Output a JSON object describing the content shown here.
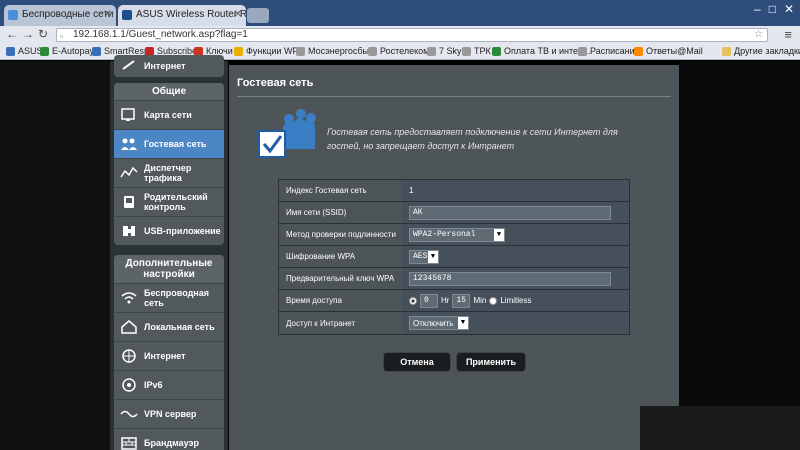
{
  "browser": {
    "tabs": [
      {
        "title": "Беспроводные сети wifi",
        "active": false
      },
      {
        "title": "ASUS Wireless Router RT-",
        "active": true
      }
    ],
    "address": "192.168.1.1/Guest_network.asp?flag=1",
    "bookmarks": [
      {
        "label": "ASUS",
        "color": "#3a6fb8"
      },
      {
        "label": "E-Autopay",
        "color": "#2a8a3a"
      },
      {
        "label": "SmartResp",
        "color": "#3a6fb8"
      },
      {
        "label": "Subscribe",
        "color": "#cc2222"
      },
      {
        "label": "Ключи",
        "color": "#cc3322"
      },
      {
        "label": "Функции WP",
        "color": "#e8b000"
      },
      {
        "label": "Мосэнергосбыт",
        "color": "#999999"
      },
      {
        "label": "Ростелеком",
        "color": "#999999"
      },
      {
        "label": "7 Sky",
        "color": "#999999"
      },
      {
        "label": "ТРК",
        "color": "#999999"
      },
      {
        "label": "Оплата ТВ и интер...",
        "color": "#2a8a3a"
      },
      {
        "label": "Расписание",
        "color": "#999999"
      },
      {
        "label": "Ответы@Mail",
        "color": "#ff8800"
      }
    ],
    "other_bookmarks": "Другие закладки"
  },
  "sidebar": {
    "top_item": "Интернет",
    "general": {
      "title": "Общие",
      "items": [
        {
          "label": "Карта сети",
          "icon": "network-map-icon"
        },
        {
          "label": "Гостевая сеть",
          "icon": "guest-network-icon",
          "active": true
        },
        {
          "label": "Диспетчер трафика",
          "icon": "traffic-manager-icon"
        },
        {
          "label": "Родительский контроль",
          "icon": "parental-control-icon"
        },
        {
          "label": "USB-приложение",
          "icon": "usb-app-icon"
        }
      ]
    },
    "advanced": {
      "title": "Дополнительные настройки",
      "items": [
        {
          "label": "Беспроводная сеть",
          "icon": "wireless-icon"
        },
        {
          "label": "Локальная сеть",
          "icon": "lan-icon"
        },
        {
          "label": "Интернет",
          "icon": "globe-icon"
        },
        {
          "label": "IPv6",
          "icon": "ipv6-icon"
        },
        {
          "label": "VPN сервер",
          "icon": "vpn-icon"
        },
        {
          "label": "Брандмауэр",
          "icon": "firewall-icon"
        }
      ]
    }
  },
  "main": {
    "title": "Гостевая сеть",
    "description": "Гостевая сеть предоставляет подключение к сети Интернет для гостей, но запрещает доступ к Интранет",
    "form": {
      "index_label": "Индекс Гостевая сеть",
      "index_value": "1",
      "ssid_label": "Имя сети (SSID)",
      "ssid_value": "AK",
      "auth_label": "Метод проверки подлинности",
      "auth_value": "WPA2-Personal",
      "enc_label": "Шифрование WPA",
      "enc_value": "AES",
      "key_label": "Предварительный ключ WPA",
      "key_value": "12345678",
      "time_label": "Время доступа",
      "hr_value": "0",
      "hr_unit": "Hr",
      "min_value": "15",
      "min_unit": "Min",
      "limitless": "Limitless",
      "intranet_label": "Доступ к Интранет",
      "intranet_value": "Отключить"
    },
    "cancel": "Отмена",
    "apply": "Применить"
  }
}
